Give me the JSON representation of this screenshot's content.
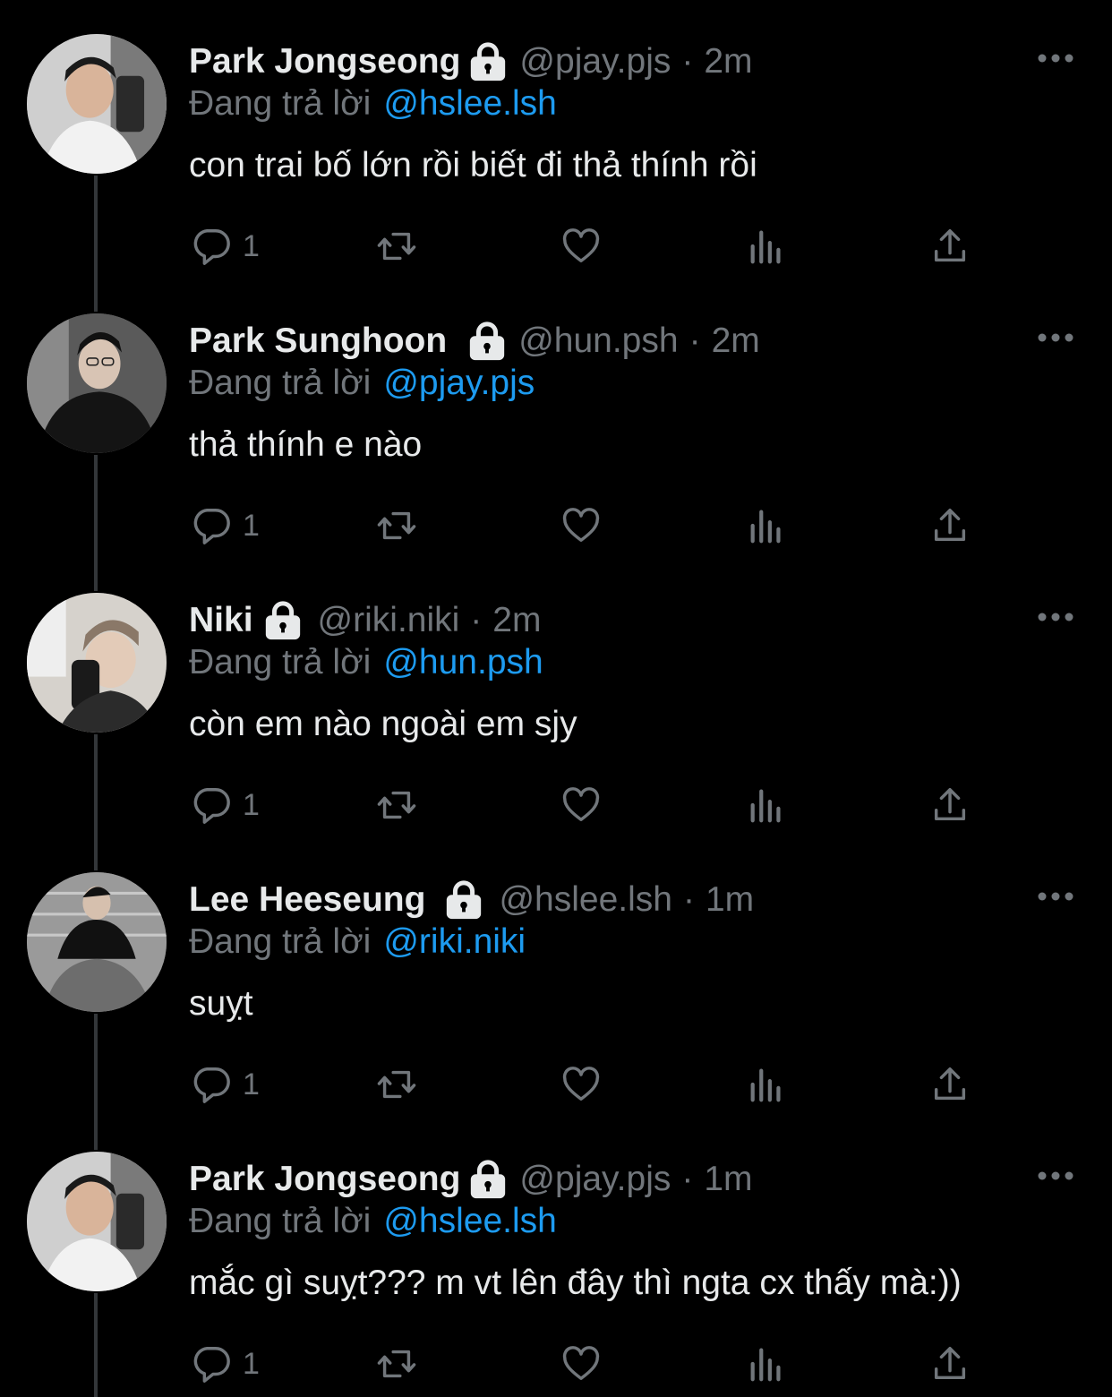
{
  "reply_prefix": "Đang trả lời",
  "colors": {
    "background": "#000000",
    "text": "#e7e9ea",
    "muted": "#71767b",
    "link": "#1d9bf0",
    "thread_line": "#333639"
  },
  "icons": {
    "lock": "lock-icon",
    "more": "more-icon",
    "reply": "reply-icon",
    "retweet": "retweet-icon",
    "like": "like-icon",
    "views": "views-icon",
    "share": "share-icon"
  },
  "tweets": [
    {
      "name": "Park Jongseong",
      "handle": "@pjay.pjs",
      "time": "2m",
      "reply_to": "@hslee.lsh",
      "text": "con trai bố lớn rồi biết đi thả thính rồi",
      "reply_count": "1"
    },
    {
      "name": "Park Sunghoon",
      "handle": "@hun.psh",
      "time": "2m",
      "reply_to": "@pjay.pjs",
      "text": "thả thính e nào",
      "reply_count": "1"
    },
    {
      "name": "Niki",
      "handle": "@riki.niki",
      "time": "2m",
      "reply_to": "@hun.psh",
      "text": "còn em nào ngoài em sjy",
      "reply_count": "1"
    },
    {
      "name": "Lee Heeseung",
      "handle": "@hslee.lsh",
      "time": "1m",
      "reply_to": "@riki.niki",
      "text": "suỵt",
      "reply_count": "1"
    },
    {
      "name": "Park Jongseong",
      "handle": "@pjay.pjs",
      "time": "1m",
      "reply_to": "@hslee.lsh",
      "text": "mắc gì suỵt??? m vt lên đây thì ngta cx thấy mà:))",
      "reply_count": "1"
    }
  ],
  "dot_separator": "·"
}
